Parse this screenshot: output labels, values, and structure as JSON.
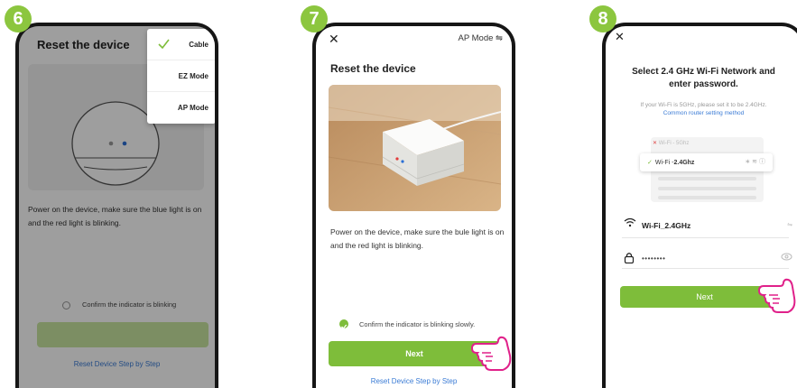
{
  "steps": {
    "s6": "6",
    "s7": "7",
    "s8": "8"
  },
  "phone6": {
    "title": "Reset the device",
    "description": "Power on the device, make sure the blue light is on and the red light is blinking.",
    "confirm": "Confirm the indicator is blinking",
    "link": "Reset Device Step by Step",
    "menu": [
      "Cable",
      "EZ Mode",
      "AP Mode"
    ]
  },
  "phone7": {
    "mode": "AP Mode ⇋",
    "title": "Reset the device",
    "description": "Power on the device, make sure the bule light is on and the red light is blinking.",
    "confirm": "Confirm the indicator is blinking slowly.",
    "next": "Next",
    "link": "Reset Device Step by Step"
  },
  "phone8": {
    "title_line1": "Select 2.4 GHz Wi-Fi Network and",
    "title_line2": "enter password.",
    "hint_line1": "If your Wi-Fi is 5GHz, please set it to be 2.4GHz.",
    "hint_link": "Common router setting method",
    "list_5g": "Wi-Fi - 5Ghz",
    "list_24_prefix": "Wi-Fi - ",
    "list_24_band": "2.4Ghz",
    "ssid": "Wi-Fi_2.4GHz",
    "password": "••••••••",
    "next": "Next"
  },
  "colors": {
    "accent": "#7ebd3a",
    "badge": "#8cc63f",
    "link": "#3a7bd5"
  }
}
